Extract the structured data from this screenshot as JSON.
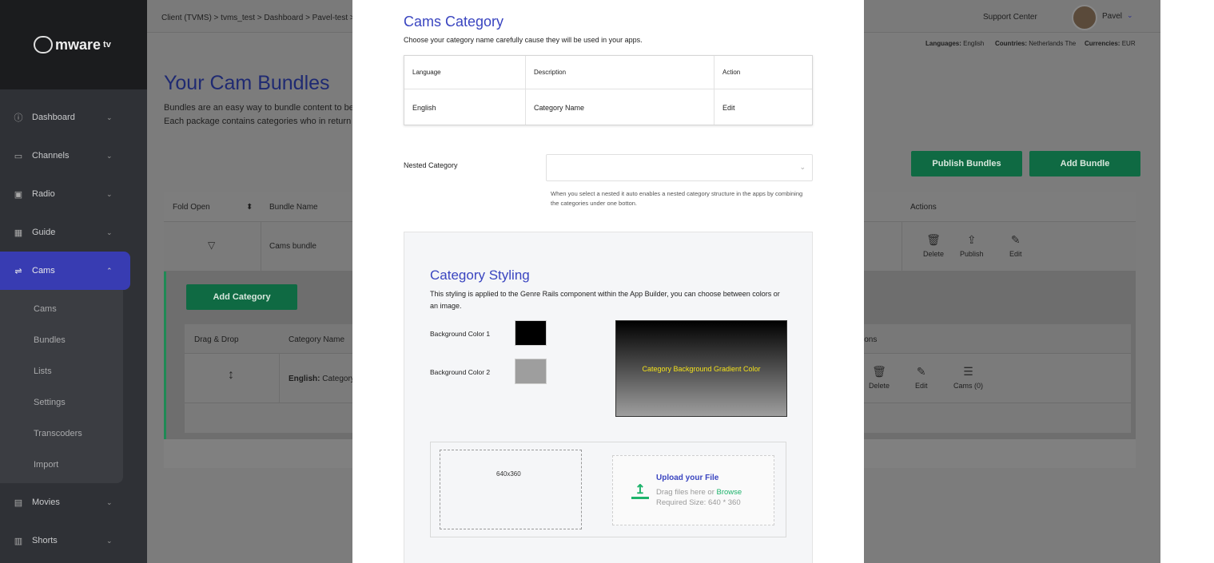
{
  "sidebar": {
    "logo": "mware",
    "logo_suffix": "tv",
    "items": [
      {
        "label": "Dashboard",
        "icon": "info-icon"
      },
      {
        "label": "Channels",
        "icon": "monitor-icon"
      },
      {
        "label": "Radio",
        "icon": "radio-icon"
      },
      {
        "label": "Guide",
        "icon": "grid-icon"
      },
      {
        "label": "Cams",
        "icon": "cam-icon"
      },
      {
        "label": "Movies",
        "icon": "film-icon"
      },
      {
        "label": "Shorts",
        "icon": "shorts-icon"
      }
    ],
    "cams_sub": [
      "Cams",
      "Bundles",
      "Lists",
      "Settings",
      "Transcoders",
      "Import"
    ]
  },
  "topbar": {
    "breadcrumb": "Client (TVMS)  > tvms_test  >  Dashboard  > Pavel-test >",
    "support": "Support Center",
    "user": "Pavel",
    "languages_label": "Languages:",
    "languages_value": "English",
    "countries_label": "Countries:",
    "countries_value": "Netherlands The",
    "currencies_label": "Currencies:",
    "currencies_value": "EUR"
  },
  "page": {
    "title": "Your Cam Bundles",
    "desc_line1": "Bundles are an easy way to bundle content to be",
    "desc_line2": "Each package contains categories who in return co",
    "publish_bundles": "Publish Bundles",
    "add_bundle": "Add Bundle",
    "headers": {
      "fold": "Fold Open",
      "bundle_name": "Bundle Name",
      "actions": "Actions"
    },
    "bundle_row": {
      "name": "Cams bundle",
      "delete": "Delete",
      "publish": "Publish",
      "edit": "Edit"
    },
    "add_category": "Add Category",
    "inner_headers": {
      "drag": "Drag & Drop",
      "category_name": "Category Name",
      "actions": "ions"
    },
    "inner_row": {
      "lang_prefix": "English:",
      "name": "Category N",
      "delete": "Delete",
      "edit": "Edit",
      "cams": "Cams (0)"
    }
  },
  "modal": {
    "title": "Cams Category",
    "subtitle": "Choose your category name carefully cause they will be used in your apps.",
    "table_headers": {
      "language": "Language",
      "description": "Description",
      "action": "Action"
    },
    "table_row": {
      "language": "English",
      "description": "Category Name",
      "action": "Edit"
    },
    "nested_label": "Nested Category",
    "nested_help": "When you select a nested it auto enables a nested category structure in the apps by combining the categories under one botton.",
    "styling_title": "Category Styling",
    "styling_desc": "This styling is applied to the Genre Rails component within the App Builder, you can choose between colors or an image.",
    "bg1_label": "Background Color 1",
    "bg1_color": "#000000",
    "bg2_label": "Background Color 2",
    "bg2_color": "#9e9e9e",
    "gradient_label": "Category Background Gradient Color",
    "preview_size": "640x360",
    "upload_title": "Upload your File",
    "upload_drag": "Drag files here or ",
    "upload_browse": "Browse",
    "upload_required": "Required Size: 640 * 360"
  }
}
